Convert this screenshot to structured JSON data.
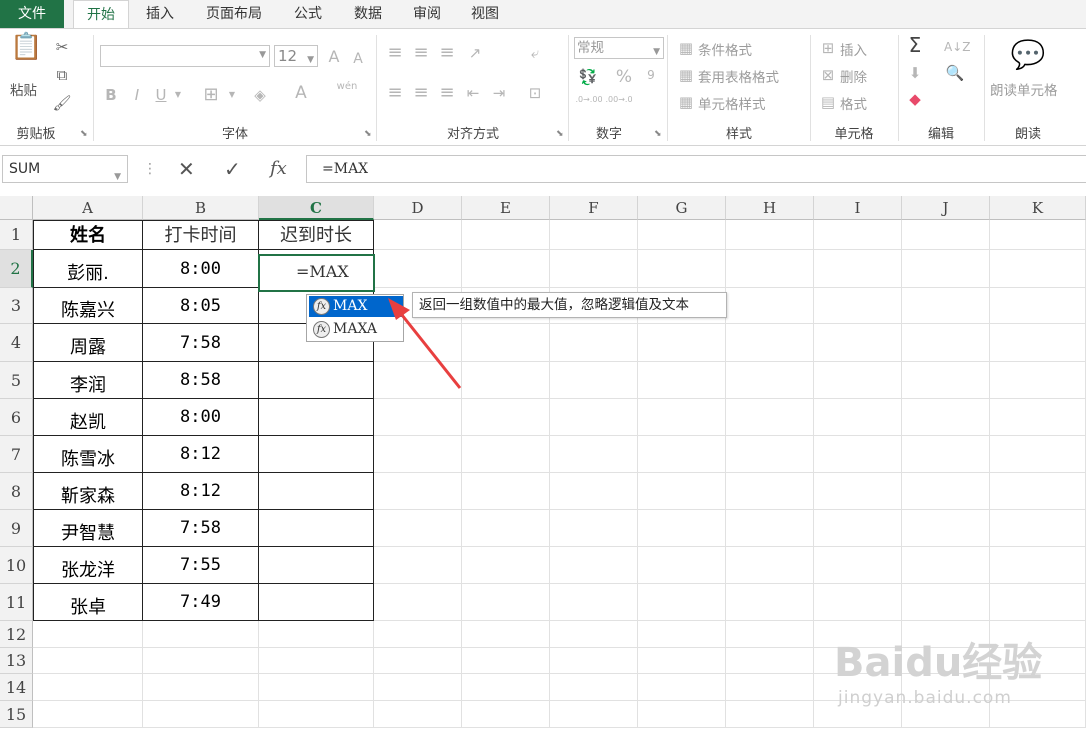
{
  "tabs": [
    "文件",
    "开始",
    "插入",
    "页面布局",
    "公式",
    "数据",
    "审阅",
    "视图"
  ],
  "ribbon": {
    "clipboard": {
      "paste": "粘贴",
      "group": "剪贴板"
    },
    "font": {
      "size": "12",
      "bold": "B",
      "italic": "I",
      "underline": "U",
      "grow": "A",
      "shrink": "A",
      "wen": "wén",
      "group": "字体"
    },
    "align": {
      "group": "对齐方式"
    },
    "number": {
      "format": "常规",
      "percent": "%",
      "comma": "9",
      "inc": ".0→.00",
      "dec": ".00→.0",
      "group": "数字"
    },
    "styles": {
      "cond": "条件格式",
      "table": "套用表格格式",
      "cell": "单元格样式",
      "group": "样式"
    },
    "cells": {
      "insert": "插入",
      "delete": "删除",
      "format": "格式",
      "group": "单元格"
    },
    "edit": {
      "sum": "Σ",
      "group": "编辑"
    },
    "read": {
      "btn": "朗读单元格",
      "group": "朗读"
    }
  },
  "formula_bar": {
    "name_box": "SUM",
    "fx": "fx",
    "content": "=MAX"
  },
  "columns": [
    "A",
    "B",
    "C",
    "D",
    "E",
    "F",
    "G",
    "H",
    "I",
    "J",
    "K"
  ],
  "rows": [
    "1",
    "2",
    "3",
    "4",
    "5",
    "6",
    "7",
    "8",
    "9",
    "10",
    "11",
    "12",
    "13",
    "14",
    "15"
  ],
  "table": {
    "headers": [
      "姓名",
      "打卡时间",
      "迟到时长"
    ],
    "names": [
      "彭丽.",
      "陈嘉兴",
      "周露",
      "李润",
      "赵凯",
      "陈雪冰",
      "靳家森",
      "尹智慧",
      "张龙洋",
      "张卓"
    ],
    "times": [
      "8:00",
      "8:05",
      "7:58",
      "8:58",
      "8:00",
      "8:12",
      "8:12",
      "7:58",
      "7:55",
      "7:49"
    ]
  },
  "active_cell": {
    "ref": "C2",
    "value": "=MAX"
  },
  "autocomplete": {
    "items": [
      "MAX",
      "MAXA"
    ],
    "tooltip": "返回一组数值中的最大值，忽略逻辑值及文本"
  },
  "colors": {
    "accent": "#217346",
    "highlight": "#0066cc",
    "arrow": "#e83f3f"
  }
}
